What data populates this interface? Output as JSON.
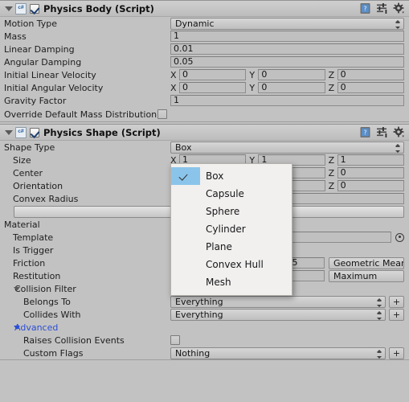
{
  "components": [
    {
      "id": "physics-body",
      "title": "Physics Body (Script)",
      "enabled": true,
      "script_icon": "c#",
      "rows": [
        {
          "label": "Motion Type",
          "type": "popup",
          "value": "Dynamic"
        },
        {
          "label": "Mass",
          "type": "text",
          "value": "1"
        },
        {
          "label": "Linear Damping",
          "type": "text",
          "value": "0.01"
        },
        {
          "label": "Angular Damping",
          "type": "text",
          "value": "0.05"
        },
        {
          "label": "Initial Linear Velocity",
          "type": "vector3",
          "axes": [
            "X",
            "Y",
            "Z"
          ],
          "value": [
            "0",
            "0",
            "0"
          ]
        },
        {
          "label": "Initial Angular Velocity",
          "type": "vector3",
          "axes": [
            "X",
            "Y",
            "Z"
          ],
          "value": [
            "0",
            "0",
            "0"
          ]
        },
        {
          "label": "Gravity Factor",
          "type": "text",
          "value": "1"
        },
        {
          "label": "Override Default Mass Distribution",
          "type": "checkbox",
          "value": false
        }
      ]
    },
    {
      "id": "physics-shape",
      "title": "Physics Shape (Script)",
      "enabled": true,
      "script_icon": "c#",
      "rows": [
        {
          "label": "Shape Type",
          "type": "popup",
          "value": "Box",
          "indent": 0
        },
        {
          "label": "Size",
          "type": "vector3",
          "axes": [
            "X",
            "Y",
            "Z"
          ],
          "value": [
            "1",
            "1",
            "1"
          ],
          "indent": 1
        },
        {
          "label": "Center",
          "type": "vector3",
          "axes": [
            "X",
            "Y",
            "Z"
          ],
          "value": [
            "0",
            "0",
            "0"
          ],
          "indent": 1
        },
        {
          "label": "Orientation",
          "type": "vector3",
          "axes": [
            "X",
            "Y",
            "Z"
          ],
          "value": [
            "0",
            "0",
            "0"
          ],
          "indent": 1
        },
        {
          "label": "Convex Radius",
          "type": "text",
          "value": "",
          "indent": 1
        },
        {
          "label": "",
          "type": "button-wide",
          "value": "",
          "indent": 1
        },
        {
          "label": "Material",
          "type": "header",
          "indent": 0
        },
        {
          "label": "Template",
          "type": "object",
          "value": "(Template)",
          "indent": 1
        },
        {
          "label": "Is Trigger",
          "type": "checkbox",
          "value": false,
          "indent": 1
        },
        {
          "label": "Friction",
          "type": "slider-op",
          "value": "0.5",
          "operator": "Geometric Mean",
          "slider_pct": 50,
          "indent": 1
        },
        {
          "label": "Restitution",
          "type": "slider-op",
          "value": "0",
          "operator": "Maximum",
          "slider_pct": 0,
          "indent": 1
        },
        {
          "label": "Collision Filter",
          "type": "foldout",
          "expanded": true,
          "indent": 1
        },
        {
          "label": "Belongs To",
          "type": "mask",
          "value": "Everything",
          "plus": "+",
          "indent": 2
        },
        {
          "label": "Collides With",
          "type": "mask",
          "value": "Everything",
          "plus": "+",
          "indent": 2
        },
        {
          "label": "Advanced",
          "type": "foldout",
          "expanded": true,
          "accent": "#2b4ed4",
          "indent": 1
        },
        {
          "label": "Raises Collision Events",
          "type": "checkbox",
          "value": false,
          "indent": 2
        },
        {
          "label": "Custom Flags",
          "type": "mask",
          "value": "Nothing",
          "plus": "+",
          "indent": 2
        }
      ]
    }
  ],
  "header_icons": [
    {
      "name": "help-icon",
      "glyph": "?"
    },
    {
      "name": "preset-icon",
      "glyph": "presets"
    },
    {
      "name": "settings-gear-icon",
      "glyph": "gear"
    }
  ],
  "shape_type_menu": {
    "open": true,
    "selected": "Box",
    "items": [
      "Box",
      "Capsule",
      "Sphere",
      "Cylinder",
      "Plane",
      "Convex Hull",
      "Mesh"
    ]
  },
  "colors": {
    "background": "#c2c2c2",
    "header_gradient_top": "#cfcfcf",
    "header_gradient_bottom": "#bdbdbd",
    "menu_background": "#f1f0ee",
    "menu_highlight": "#8bc4ea",
    "accent_blue": "#2b4ed4",
    "field_background": "#c0c0c0"
  }
}
